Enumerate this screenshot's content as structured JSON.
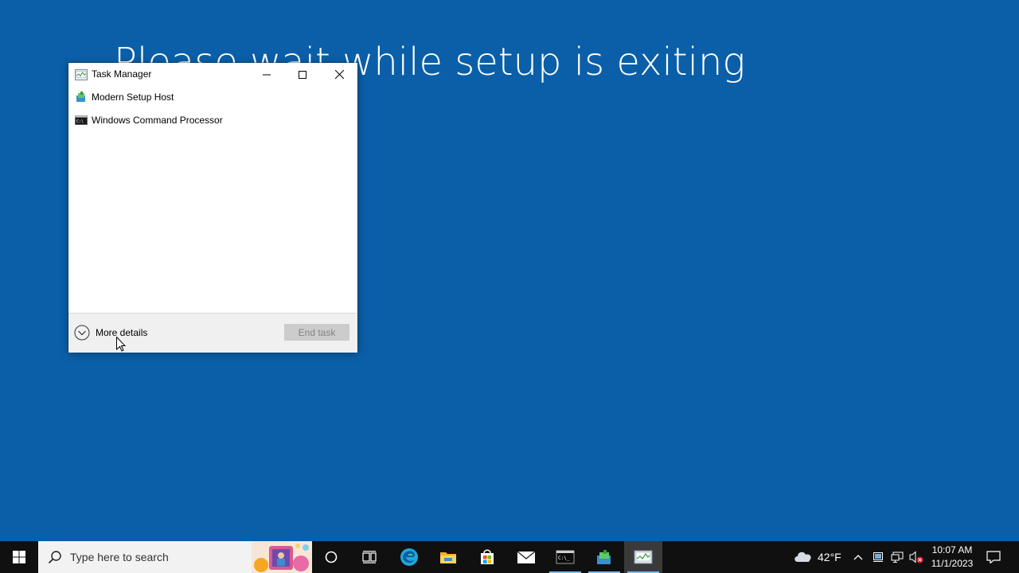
{
  "desktop": {
    "message": "Please wait while setup is exiting",
    "background_color": "#0a5fa8"
  },
  "task_manager": {
    "title": "Task Manager",
    "processes": [
      {
        "label": "Modern Setup Host",
        "icon": "setup-host-icon"
      },
      {
        "label": "Windows Command Processor",
        "icon": "command-prompt-icon"
      }
    ],
    "more_details_label": "More details",
    "end_task_label": "End task"
  },
  "taskbar": {
    "search_placeholder": "Type here to search",
    "pinned": [
      "cortana-icon",
      "task-view-icon",
      "edge-icon",
      "file-explorer-icon",
      "store-icon",
      "mail-icon",
      "command-prompt-icon",
      "setup-host-icon",
      "task-manager-icon"
    ],
    "weather_temp": "42°F",
    "time": "10:07 AM",
    "date": "11/1/2023",
    "active_indicator_color": "#76b9ed"
  }
}
